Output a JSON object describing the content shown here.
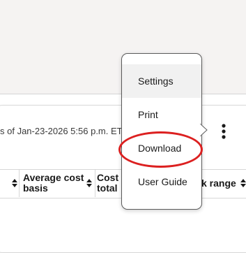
{
  "holdings": {
    "timestamp_text": "s of Jan-23-2026 5:56 p.m. ET",
    "columns": [
      {
        "label_line1": "",
        "label_line2": ""
      },
      {
        "label_line1": "Average cost",
        "label_line2": "basis"
      },
      {
        "label_line1": "Cost b",
        "label_line2": "total"
      },
      {
        "label_line1": "k range",
        "label_line2": ""
      }
    ],
    "more_options_icon": "vertical-ellipsis-icon",
    "sort_icon": "sort-updown-icon"
  },
  "menu": {
    "items": [
      {
        "label": "Settings",
        "highlighted": true
      },
      {
        "label": "Print",
        "highlighted": false
      },
      {
        "label": "Download",
        "highlighted": false
      },
      {
        "label": "User Guide",
        "highlighted": false
      }
    ]
  },
  "annotation": {
    "target": "Download",
    "color": "#dc2020"
  }
}
